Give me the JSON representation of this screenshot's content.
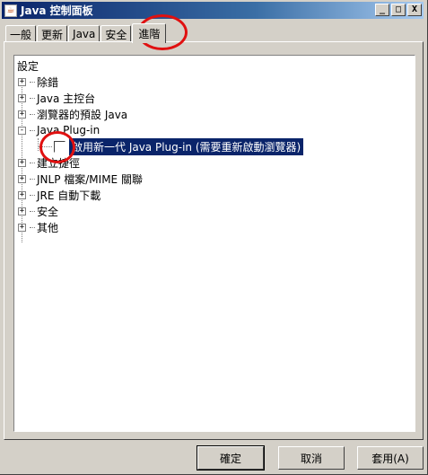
{
  "window": {
    "title": "Java 控制面板",
    "icon": "java-cup-icon",
    "controls": [
      "_",
      "□",
      "X"
    ]
  },
  "tabs": [
    {
      "label": "一般",
      "active": false
    },
    {
      "label": "更新",
      "active": false
    },
    {
      "label": "Java",
      "active": false
    },
    {
      "label": "安全",
      "active": false
    },
    {
      "label": "進階",
      "active": true
    }
  ],
  "tree": {
    "root": "設定",
    "items": [
      {
        "label": "除錯",
        "expander": "+"
      },
      {
        "label": "Java 主控台",
        "expander": "+"
      },
      {
        "label": "瀏覽器的預設 Java",
        "expander": "+"
      },
      {
        "label": "Java Plug-in",
        "expander": "-"
      },
      {
        "label": "啟用新一代 Java Plug-in (需要重新啟動瀏覽器)",
        "checkbox": true,
        "checked": false,
        "selected": true
      },
      {
        "label": "建立捷徑",
        "expander": "+"
      },
      {
        "label": "JNLP 檔案/MIME 關聯",
        "expander": "+"
      },
      {
        "label": "JRE 自動下載",
        "expander": "+"
      },
      {
        "label": "安全",
        "expander": "+"
      },
      {
        "label": "其他",
        "expander": "+"
      }
    ]
  },
  "buttons": {
    "ok": "確定",
    "cancel": "取消",
    "apply": "套用(A)"
  },
  "colors": {
    "selection": "#0a246a",
    "annotation": "#e01010",
    "titlebar": "#0a246a"
  }
}
